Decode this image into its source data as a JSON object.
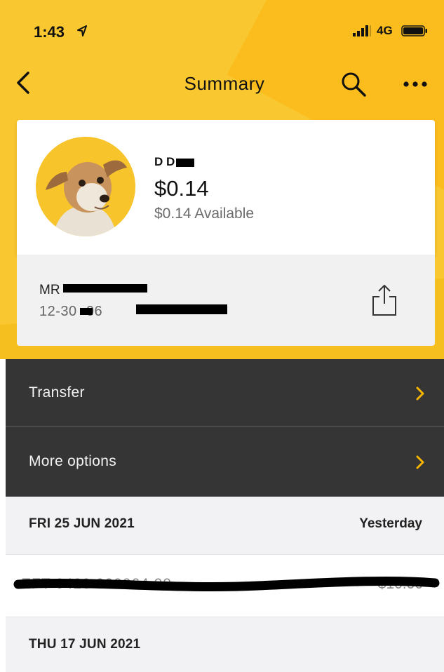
{
  "status_bar": {
    "time": "1:43",
    "network": "4G"
  },
  "nav": {
    "title": "Summary"
  },
  "account": {
    "name": "D D",
    "balance": "$0.14",
    "available": "$0.14 Available",
    "holder_name": "MR",
    "account_number": "12-30 -06"
  },
  "menu": {
    "items": [
      {
        "label": "Transfer"
      },
      {
        "label": "More options"
      }
    ]
  },
  "transactions": {
    "groups": [
      {
        "date": "FRI 25 JUN 2021",
        "relative": "Yesterday"
      },
      {
        "date": "THU 17 JUN 2021",
        "relative": ""
      }
    ],
    "rows": [
      {
        "description": "EFT 0420 000064 00",
        "amount": "$10.00"
      }
    ]
  },
  "colors": {
    "brand_yellow": "#f9c730",
    "menu_dark": "#353535",
    "chevron": "#f4b400"
  }
}
